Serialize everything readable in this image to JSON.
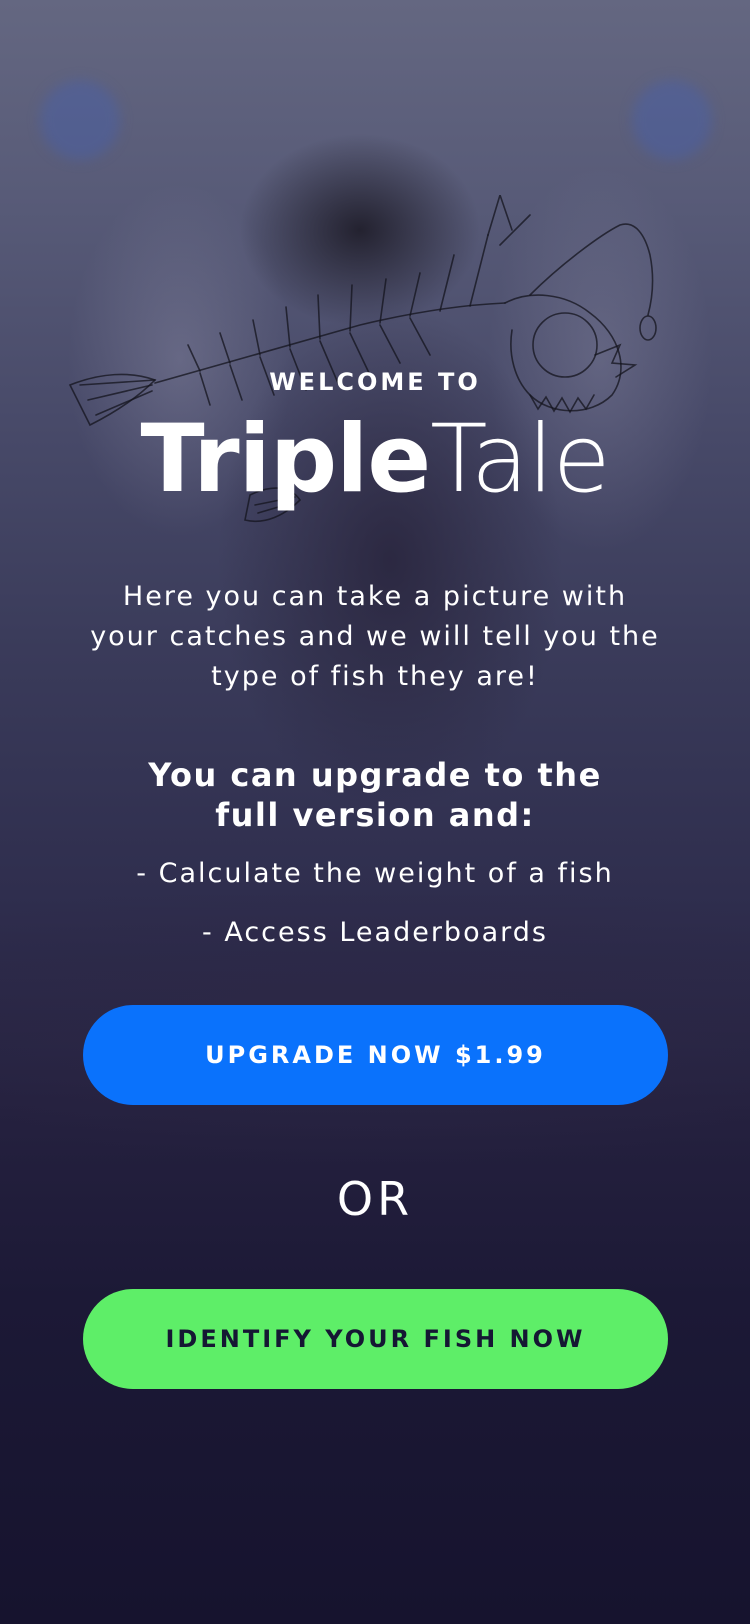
{
  "welcome": {
    "label": "WELCOME TO",
    "logo_bold": "Triple",
    "logo_light": "Tale",
    "logo_icon": "anglerfish-skeleton-illustration"
  },
  "intro": {
    "text": "Here you can take a picture with your catches and we will tell you the type of fish they are!"
  },
  "upgrade": {
    "title": "You can upgrade to the full version and:",
    "features": [
      "- Calculate the weight of a fish",
      "- Access Leaderboards"
    ],
    "button_label": "UPGRADE NOW $1.99"
  },
  "divider": {
    "label": "OR"
  },
  "identify": {
    "button_label": "IDENTIFY YOUR FISH NOW"
  },
  "colors": {
    "upgrade_button": "#0a72fc",
    "identify_button": "#5eee68",
    "identify_text": "#151733",
    "background_bottom": "#16132e"
  }
}
